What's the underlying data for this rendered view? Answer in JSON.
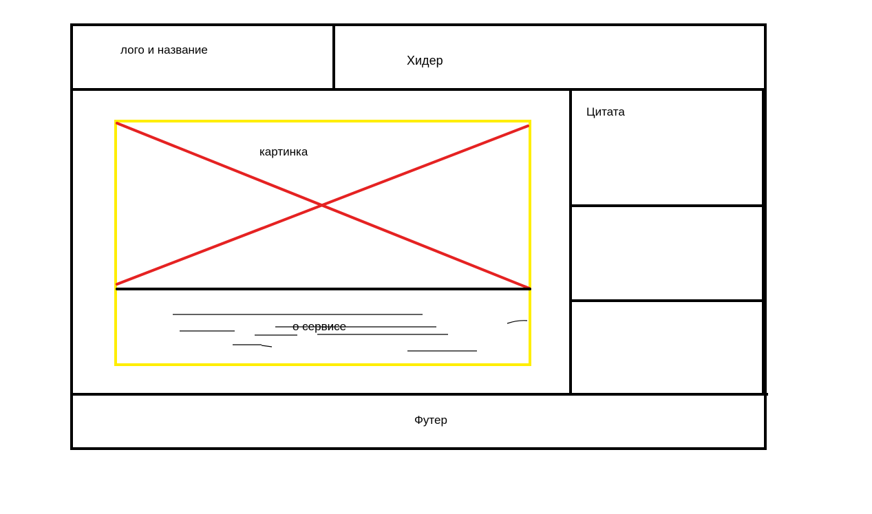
{
  "labels": {
    "logo": "лого и название",
    "header": "Хидер",
    "quote": "Цитата",
    "image": "картинка",
    "about": "о сервисе",
    "footer": "Футер"
  },
  "colors": {
    "outline": "#000000",
    "image_frame": "#ffee00",
    "cross": "#e52222",
    "background": "#ffffff"
  }
}
